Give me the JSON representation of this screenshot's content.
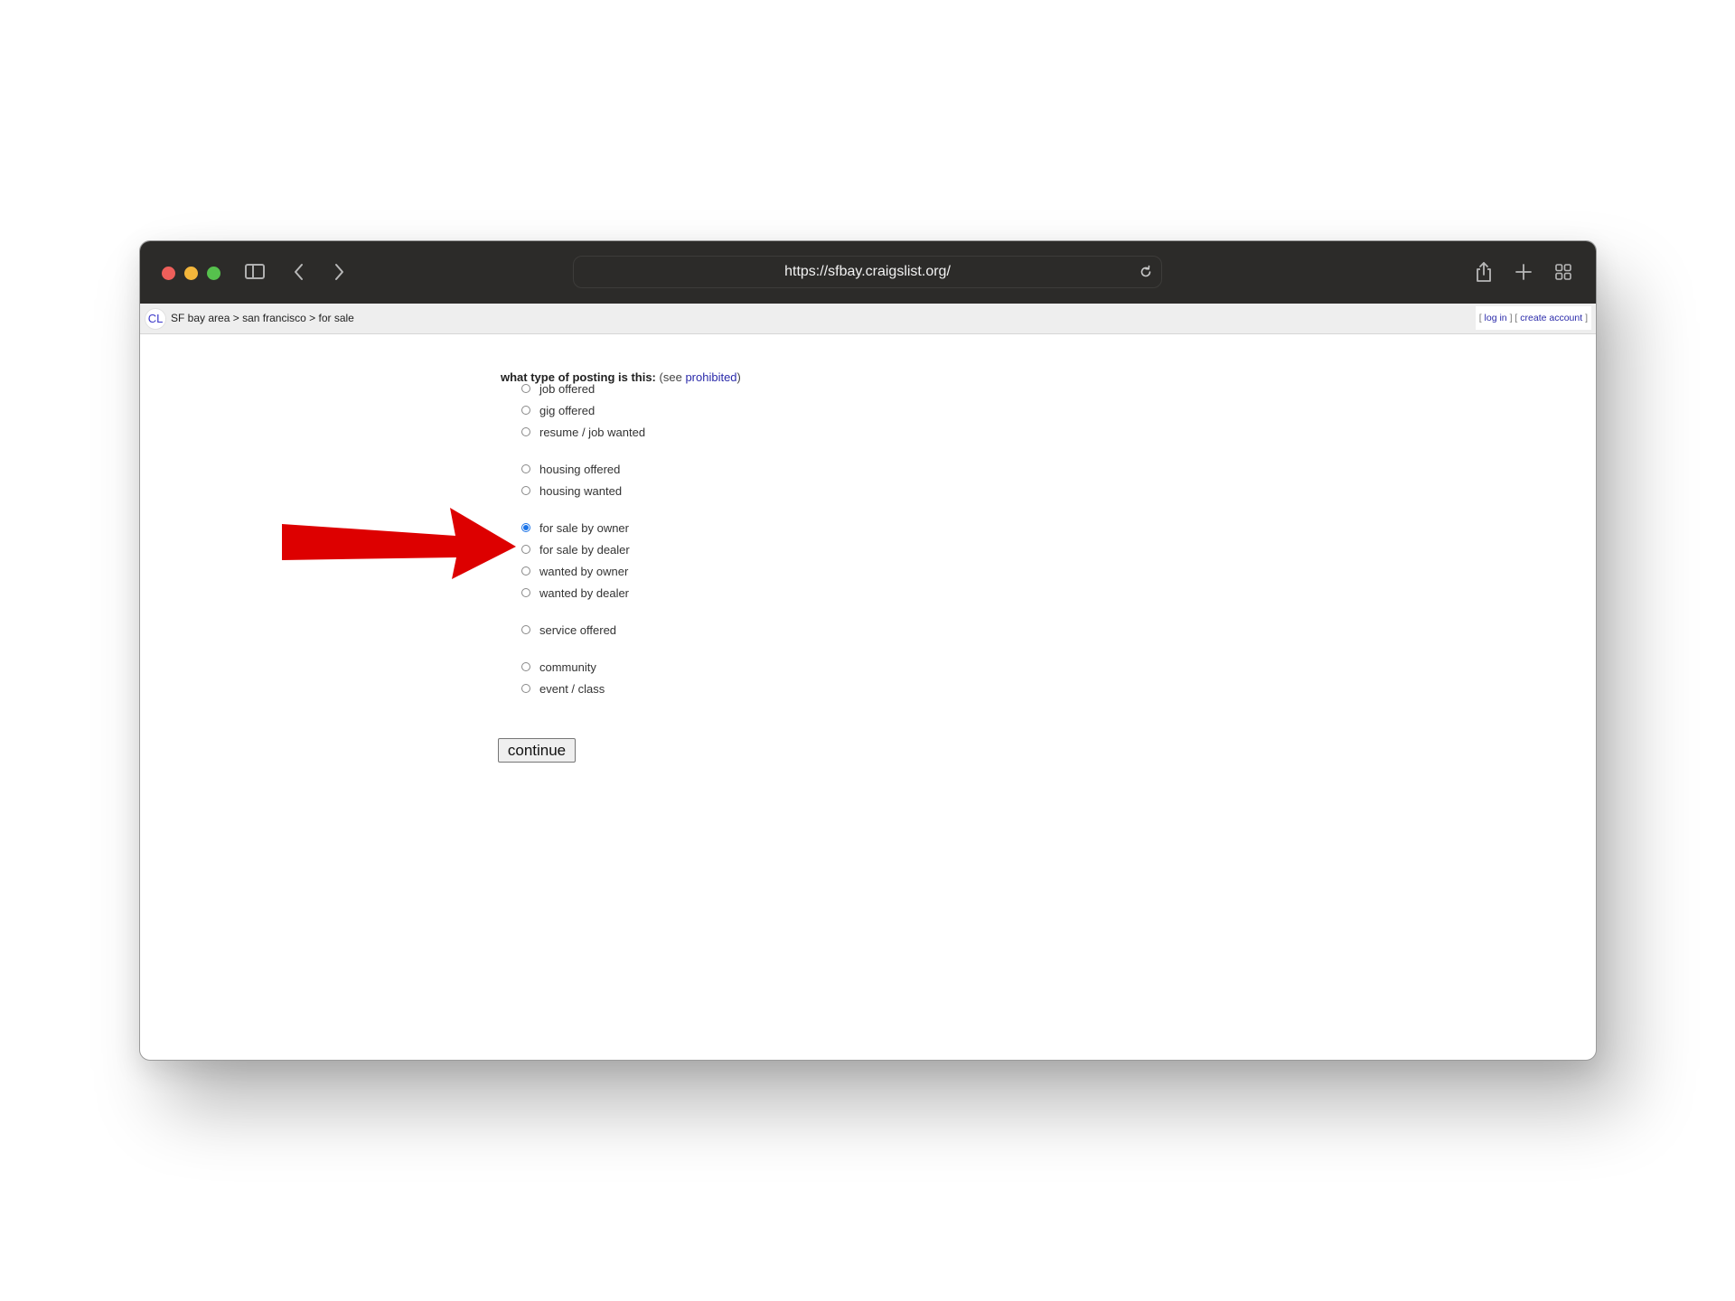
{
  "browser": {
    "url": "https://sfbay.craigslist.org/",
    "icons": {
      "sidebar": "sidebar-icon",
      "back": "chevron-left-icon",
      "forward": "chevron-right-icon",
      "reload": "reload-icon",
      "share": "share-icon",
      "new_tab": "plus-icon",
      "tabs_overview": "grid-icon"
    }
  },
  "breadcrumb": {
    "logo": "CL",
    "items": [
      "SF bay area",
      "san francisco",
      "for sale"
    ],
    "separator": ">"
  },
  "account": {
    "open_bracket": "[",
    "close_bracket": "]",
    "login_label": "log in",
    "create_label": "create account"
  },
  "form": {
    "question": "what type of posting is this:",
    "see_prefix": "(see",
    "prohibited_link": "prohibited",
    "see_suffix": ")",
    "options": [
      {
        "label": "job offered",
        "checked": false
      },
      {
        "label": "gig offered",
        "checked": false
      },
      {
        "label": "resume / job wanted",
        "checked": false
      },
      {
        "label": "housing offered",
        "checked": false
      },
      {
        "label": "housing wanted",
        "checked": false
      },
      {
        "label": "for sale by owner",
        "checked": true
      },
      {
        "label": "for sale by dealer",
        "checked": false
      },
      {
        "label": "wanted by owner",
        "checked": false
      },
      {
        "label": "wanted by dealer",
        "checked": false
      },
      {
        "label": "service offered",
        "checked": false
      },
      {
        "label": "community",
        "checked": false
      },
      {
        "label": "event / class",
        "checked": false
      }
    ],
    "continue_label": "continue"
  },
  "annotation": {
    "type": "arrow",
    "color": "#dd0000",
    "points_to": "for sale by owner"
  }
}
